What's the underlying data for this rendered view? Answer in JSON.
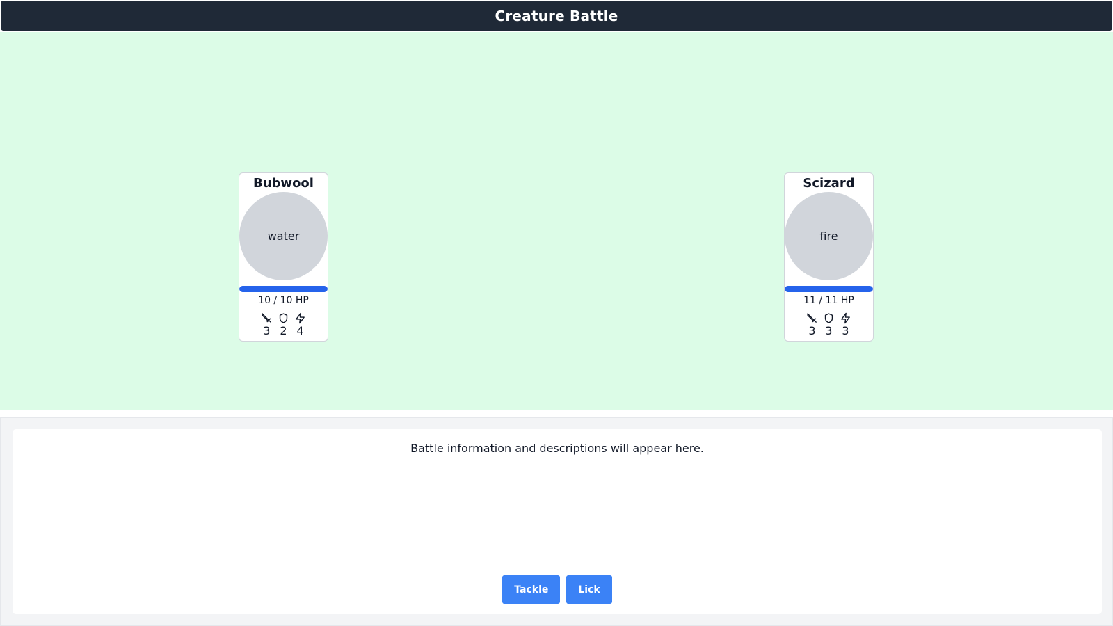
{
  "header": {
    "title": "Creature Battle"
  },
  "player": {
    "name": "Bubwool",
    "type": "water",
    "hp_text": "10 / 10 HP",
    "hp_fraction": 1.0,
    "stats": {
      "attack": "3",
      "defense": "2",
      "speed": "4"
    }
  },
  "opponent": {
    "name": "Scizard",
    "type": "fire",
    "hp_text": "11 / 11 HP",
    "hp_fraction": 1.0,
    "stats": {
      "attack": "3",
      "defense": "3",
      "speed": "3"
    }
  },
  "info": {
    "text": "Battle information and descriptions will appear here."
  },
  "moves": [
    {
      "label": "Tackle"
    },
    {
      "label": "Lick"
    }
  ],
  "icons": {
    "attack": "sword-icon",
    "defense": "shield-icon",
    "speed": "lightning-icon"
  },
  "colors": {
    "header": "#1f2937",
    "arena": "#dcfce7",
    "hp_bar": "#2563eb",
    "button": "#3b82f6",
    "portrait": "#d1d5db"
  }
}
